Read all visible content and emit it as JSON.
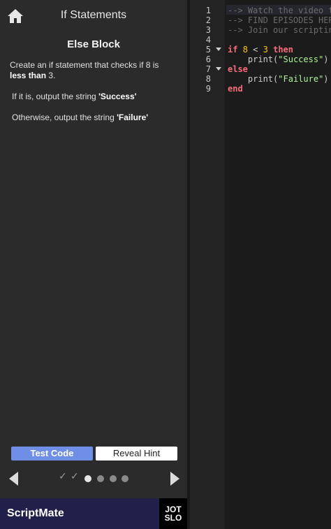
{
  "header": {
    "title": "If Statements",
    "home_icon": "home-icon"
  },
  "lesson": {
    "block_title": "Else Block",
    "instruction_1_prefix": "Create an if statement that checks if 8 is ",
    "instruction_1_bold": "less than",
    "instruction_1_suffix": " 3.",
    "instruction_2_prefix": "If it is, output the string ",
    "instruction_2_bold": "'Success'",
    "instruction_3_prefix": "Otherwise, output the string ",
    "instruction_3_bold": "'Failure'"
  },
  "buttons": {
    "test_code": "Test Code",
    "reveal_hint": "Reveal Hint"
  },
  "pager": {
    "completed_steps": 2,
    "total_steps": 6,
    "current_step": 3,
    "prev_icon": "arrow-left-icon",
    "next_icon": "arrow-right-icon",
    "check_glyph": "✓"
  },
  "branding": {
    "name": "ScriptMate",
    "logo_line_1": "JOT",
    "logo_line_2": "SLO",
    "bar_color": "#20204a"
  },
  "editor": {
    "line_numbers": [
      "1",
      "2",
      "3",
      "4",
      "5",
      "6",
      "7",
      "8",
      "9"
    ],
    "comments": [
      "--> Watch the video t",
      "--> FIND EPISODES HER",
      "--> Join our scriptin"
    ],
    "code": {
      "kw_if": "if",
      "num_8": "8",
      "op_lt": "<",
      "num_3": "3",
      "kw_then": "then",
      "fn_print": "print",
      "paren_open": "(",
      "paren_close": ")",
      "str_success": "\"Success\"",
      "kw_else": "else",
      "str_failure": "\"Failure\"",
      "kw_end": "end"
    },
    "colors": {
      "keyword": "#f86d7c",
      "number": "#ffc600",
      "string": "#adf195",
      "comment": "#6b6b6b"
    }
  }
}
